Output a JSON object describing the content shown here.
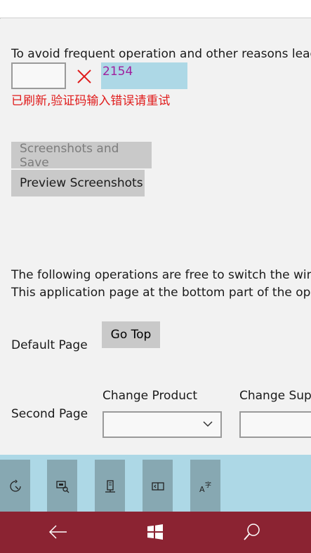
{
  "notice": "To avoid frequent operation and other reasons lead t",
  "captcha": {
    "value": "",
    "code": "2154",
    "error": "已刷新,验证码输入错误请重试"
  },
  "buttons": {
    "save": "Screenshots and Save",
    "preview": "Preview Screenshots",
    "go_top": "Go Top"
  },
  "info": {
    "line1": "The following operations are free to switch the windo",
    "line2": "This application page at the bottom part of the oper"
  },
  "pages": {
    "default_label": "Default Page",
    "second_label": "Second Page"
  },
  "selectors": {
    "product_label": "Change Product",
    "supplier_label": "Change Supp",
    "product_value": "",
    "supplier_value": ""
  },
  "appbar": {
    "icons": [
      "rotate-icon",
      "screen-search-icon",
      "phone-device-icon",
      "screen-split-icon",
      "translate-icon"
    ]
  },
  "navbar": {
    "icons": [
      "back-arrow-icon",
      "windows-start-icon",
      "search-icon"
    ]
  },
  "colors": {
    "captcha_bg": "#add8e6",
    "captcha_code": "#a0209e",
    "error_text": "#e01b1b",
    "appbar_bg": "#add8e6",
    "appbar_button": "#87a8b2",
    "navbar_bg": "#8b2332"
  }
}
